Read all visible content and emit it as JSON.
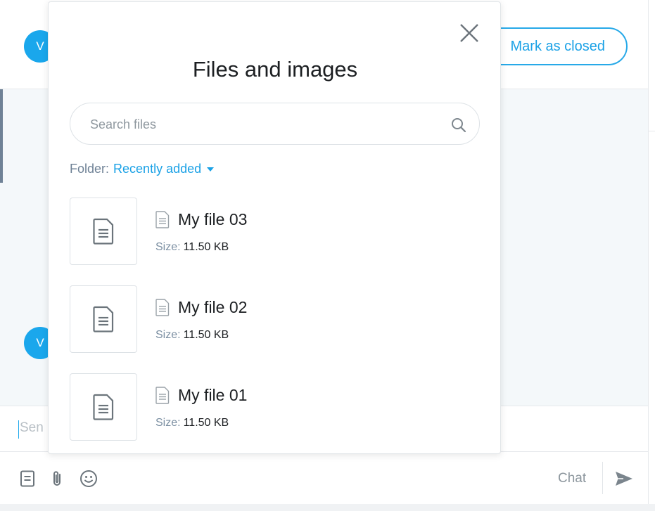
{
  "background": {
    "avatar_initial": "V",
    "mark_closed_label": "Mark as closed",
    "composer_placeholder": "Send a message...",
    "composer_visible": "Sen",
    "chat_label": "Chat",
    "toolbar_icons": [
      "note-icon",
      "paperclip-icon",
      "emoji-icon",
      "send-icon"
    ]
  },
  "modal": {
    "title": "Files and images",
    "search_placeholder": "Search files",
    "folder_label": "Folder:",
    "folder_value": "Recently added",
    "size_label": "Size:",
    "files": [
      {
        "name": "My file 03",
        "size": "11.50 KB"
      },
      {
        "name": "My file 02",
        "size": "11.50 KB"
      },
      {
        "name": "My file 01",
        "size": "11.50 KB"
      }
    ]
  },
  "colors": {
    "accent": "#1aa1e6",
    "avatar": "#1aa7ec",
    "muted_label": "#7b8fa2",
    "message_bg": "#f4f8fa"
  }
}
